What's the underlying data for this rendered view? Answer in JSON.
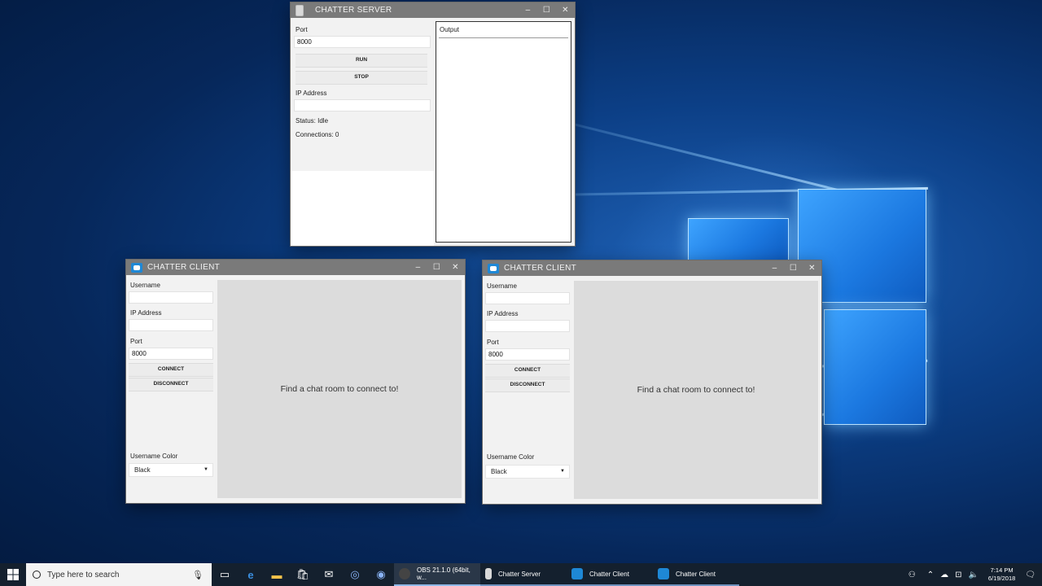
{
  "colors": {
    "titlebar": "#7a7a7a",
    "accent": "#1e88d6",
    "taskbar": "#14202e"
  },
  "server": {
    "title": "CHATTER SERVER",
    "port_label": "Port",
    "port_value": "8000",
    "run_label": "RUN",
    "stop_label": "STOP",
    "ip_label": "IP Address",
    "ip_value": "",
    "status": "Status: Idle",
    "connections": "Connections: 0",
    "output_label": "Output",
    "controls": {
      "minimize": "–",
      "maximize": "☐",
      "close": "✕"
    }
  },
  "client1": {
    "title": "CHATTER CLIENT",
    "username_label": "Username",
    "username_value": "",
    "ip_label": "IP Address",
    "ip_value": "",
    "port_label": "Port",
    "port_value": "8000",
    "connect_label": "CONNECT",
    "disconnect_label": "DISCONNECT",
    "color_label": "Username Color",
    "color_value": "Black",
    "chat_message": "Find a chat room to connect to!",
    "controls": {
      "minimize": "–",
      "maximize": "☐",
      "close": "✕"
    }
  },
  "client2": {
    "title": "CHATTER CLIENT",
    "username_label": "Username",
    "username_value": "",
    "ip_label": "IP Address",
    "ip_value": "",
    "port_label": "Port",
    "port_value": "8000",
    "connect_label": "CONNECT",
    "disconnect_label": "DISCONNECT",
    "color_label": "Username Color",
    "color_value": "Black",
    "chat_message": "Find a chat room to connect to!",
    "controls": {
      "minimize": "–",
      "maximize": "☐",
      "close": "✕"
    }
  },
  "taskbar": {
    "search_placeholder": "Type here to search",
    "apps": [
      {
        "label": "OBS 21.1.0 (64bit, w..."
      },
      {
        "label": "Chatter Server"
      },
      {
        "label": "Chatter Client"
      },
      {
        "label": "Chatter Client"
      }
    ],
    "time": "7:14 PM",
    "date": "6/19/2018"
  }
}
